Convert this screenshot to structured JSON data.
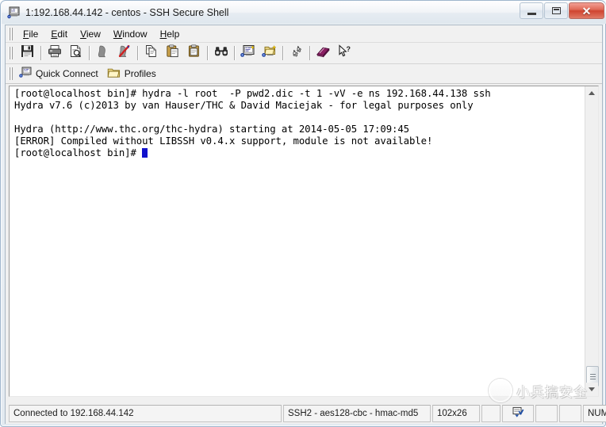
{
  "window": {
    "title": "1:192.168.44.142 - centos - SSH Secure Shell",
    "icon": "ssh-terminal-icon",
    "controls": {
      "minimize": "Minimize",
      "maximize": "Maximize",
      "close": "Close"
    }
  },
  "menubar": {
    "items": [
      {
        "label": "File",
        "mnemonic": "F",
        "name": "menu-file"
      },
      {
        "label": "Edit",
        "mnemonic": "E",
        "name": "menu-edit"
      },
      {
        "label": "View",
        "mnemonic": "V",
        "name": "menu-view"
      },
      {
        "label": "Window",
        "mnemonic": "W",
        "name": "menu-window"
      },
      {
        "label": "Help",
        "mnemonic": "H",
        "name": "menu-help"
      }
    ]
  },
  "toolbar": {
    "buttons": [
      {
        "icon": "save-icon",
        "title": "Save"
      },
      {
        "sep": true
      },
      {
        "icon": "print-icon",
        "title": "Print"
      },
      {
        "icon": "print-preview-icon",
        "title": "Print Preview"
      },
      {
        "sep": true
      },
      {
        "icon": "connect-icon",
        "title": "Connect"
      },
      {
        "icon": "disconnect-icon",
        "title": "Disconnect"
      },
      {
        "sep": true
      },
      {
        "icon": "copy-icon",
        "title": "Copy"
      },
      {
        "icon": "paste-icon",
        "title": "Paste"
      },
      {
        "icon": "copy-paste-icon",
        "title": "Copy and Paste"
      },
      {
        "sep": true
      },
      {
        "icon": "find-icon",
        "title": "Find"
      },
      {
        "sep": true
      },
      {
        "icon": "new-terminal-icon",
        "title": "New Terminal Window"
      },
      {
        "icon": "new-file-transfer-icon",
        "title": "New File Transfer Window"
      },
      {
        "sep": true
      },
      {
        "icon": "settings-icon",
        "title": "Settings"
      },
      {
        "sep": true
      },
      {
        "icon": "help-book-icon",
        "title": "Help"
      },
      {
        "icon": "context-help-icon",
        "title": "Context Help"
      }
    ]
  },
  "quickbar": {
    "quick_connect": "Quick Connect",
    "profiles": "Profiles"
  },
  "terminal": {
    "lines": [
      "[root@localhost bin]# hydra -l root  -P pwd2.dic -t 1 -vV -e ns 192.168.44.138 ssh",
      "Hydra v7.6 (c)2013 by van Hauser/THC & David Maciejak - for legal purposes only",
      "",
      "Hydra (http://www.thc.org/thc-hydra) starting at 2014-05-05 17:09:45",
      "[ERROR] Compiled without LIBSSH v0.4.x support, module is not available!"
    ],
    "prompt": "[root@localhost bin]# ",
    "cursor_color": "#1111cc",
    "background": "#ffffff",
    "foreground": "#000000"
  },
  "scrollbar": {
    "up_arrow": "scroll-up-arrow",
    "down_arrow": "scroll-down-arrow",
    "thumb": "scroll-thumb"
  },
  "statusbar": {
    "connection": "Connected to 192.168.44.142",
    "cipher": "SSH2 - aes128-cbc - hmac-md5",
    "size": "102x26",
    "indicator_icon": "encryption-icon",
    "num_lock": "NUM"
  },
  "watermark": {
    "text": "小兵搞安全",
    "logo": "wechat-account-logo"
  }
}
